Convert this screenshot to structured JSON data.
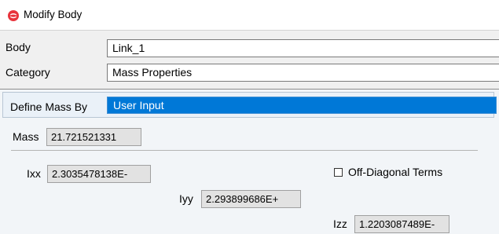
{
  "window": {
    "title": "Modify Body",
    "icon": "app-logo-icon"
  },
  "form": {
    "body_label": "Body",
    "body_value": "Link_1",
    "category_label": "Category",
    "category_value": "Mass Properties",
    "define_mass_label": "Define Mass By",
    "define_mass_value": "User Input",
    "mass_label": "Mass",
    "mass_value": "21.721521331",
    "ixx_label": "Ixx",
    "ixx_value": "2.3035478138E-",
    "iyy_label": "Iyy",
    "iyy_value": "2.293899686E+",
    "izz_label": "Izz",
    "izz_value": "1.2203087489E-",
    "off_diagonal_label": "Off-Diagonal Terms",
    "off_diagonal_checked": false
  },
  "colors": {
    "selection": "#0078d7",
    "panel": "#f0f0f0",
    "logo": "#e8343c"
  }
}
